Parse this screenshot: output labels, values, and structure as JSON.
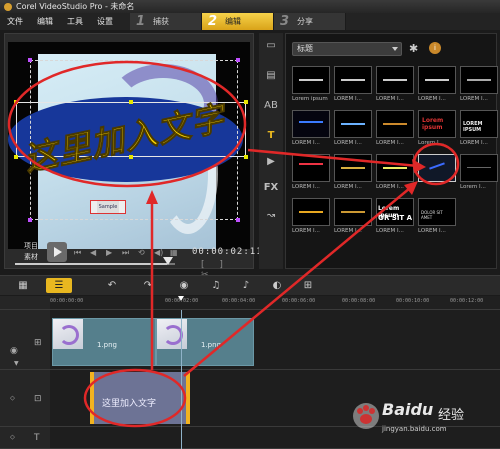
{
  "window": {
    "title": "Corel VideoStudio Pro - 未命名"
  },
  "menu": [
    "文件",
    "编辑",
    "工具",
    "设置"
  ],
  "steps": [
    {
      "num": "1",
      "label": "捕获",
      "active": false
    },
    {
      "num": "2",
      "label": "编辑",
      "active": true
    },
    {
      "num": "3",
      "label": "分享",
      "active": false
    }
  ],
  "preview": {
    "overlay_text": "这里加入文字",
    "small_tag": "Sample",
    "mode_labels": [
      "项目",
      "素材"
    ],
    "timecode": "00:00:02",
    "timecode_frames": "11"
  },
  "library": {
    "category": "标题",
    "badge": "i",
    "thumbs": [
      {
        "caption": "Lorem ipsum"
      },
      {
        "caption": "LOREM I..."
      },
      {
        "caption": "LOREM I..."
      },
      {
        "caption": "LOREM I..."
      },
      {
        "caption": "LOREM I..."
      },
      {
        "caption": "LOREM I..."
      },
      {
        "caption": "LOREM I..."
      },
      {
        "caption": "LOREM I..."
      },
      {
        "caption": "Lorem I..."
      },
      {
        "caption": "LOREM I..."
      },
      {
        "caption": "LOREM I..."
      },
      {
        "caption": "LOREM I..."
      },
      {
        "caption": "LOREM I..."
      },
      {
        "caption": ""
      },
      {
        "caption": "Lorem I..."
      },
      {
        "caption": "LOREM I..."
      },
      {
        "caption": "LOREM I..."
      },
      {
        "caption": "LOREM I..."
      },
      {
        "caption": "LOREM I..."
      }
    ],
    "thumb_texts": {
      "t15": "Lorem Ipsum",
      "t16": "DOLOR SIT AMET",
      "t17": "DOLOR SIT AMET",
      "t11": "Lorem ipsum",
      "t12": "LOREM IPSUM",
      "t18": "OR SIT A"
    }
  },
  "timeline": {
    "ruler_ticks": [
      "00:00:00:00",
      "00:00:02:00",
      "00:00:04:00",
      "00:00:06:00",
      "00:00:08:00",
      "00:00:10:00",
      "00:00:12:00"
    ],
    "clips": [
      {
        "name": "1.png"
      },
      {
        "name": "1.png"
      }
    ],
    "title_clip": "这里加入文字"
  },
  "watermark": {
    "brand": "Baidu",
    "brand_cn": "经验",
    "url": "jingyan.baidu.com"
  },
  "colors": {
    "accent": "#e8b720",
    "annotation_red": "#e02828",
    "overlay_text": "#ffd800",
    "clip_blue": "#557f8c",
    "title_clip": "#6d7395"
  }
}
